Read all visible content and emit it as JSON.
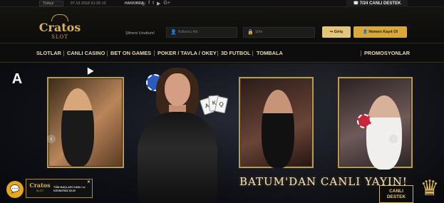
{
  "topbar": {
    "language": "Türkçe",
    "datetime": "07.10.2018 01:26:13",
    "about": "HAKKINDA",
    "social_icons": [
      "instagram-icon",
      "facebook-icon",
      "twitter-icon",
      "youtube-icon",
      "google-plus-icon"
    ],
    "social_glyphs": [
      "◎",
      "f",
      "t",
      "▶",
      "G+"
    ],
    "support": "7/24 CANLI DESTEK"
  },
  "header": {
    "logo_main": "Cratos",
    "logo_sub": "SLOT",
    "forgot": "Şifremi Unuttum!",
    "username_placeholder": "Kullanıcı Adı",
    "password_placeholder": "Şifre",
    "login_label": "Giriş",
    "register_label": "Hemen Kayıt Ol"
  },
  "nav": {
    "items": [
      "SLOTLAR",
      "CANLI CASINO",
      "BET ON GAMES",
      "POKER / TAVLA / OKEY",
      "3D FUTBOL",
      "TOMBALA"
    ],
    "promotions": "PROMOSYONLAR"
  },
  "hero": {
    "headline": "BATUM'DAN CANLI YAYIN!",
    "card_ranks": [
      "A",
      "K",
      "Q"
    ]
  },
  "widgets": {
    "promo_logo_main": "Cratos",
    "promo_logo_sub": "SLOT",
    "promo_text": "TÜM MAÇLARI CANLI ve KESİNTİSİZ İZLE!",
    "promo_close": "✕",
    "support_badge_line1": "CANLI",
    "support_badge_line2": "DESTEK"
  },
  "colors": {
    "gold": "#d6b25e",
    "register": "#d8a93a",
    "login": "#e2c67c",
    "chat": "#e5a81c"
  }
}
